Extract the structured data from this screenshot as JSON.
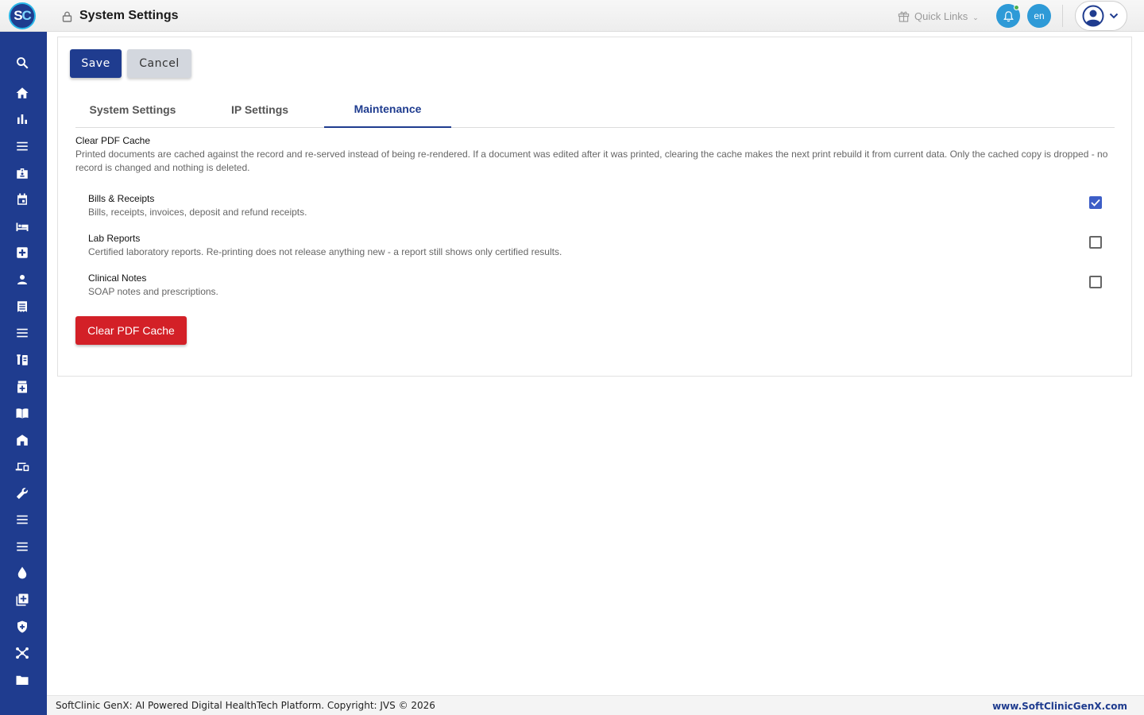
{
  "app": {
    "logo_text": "SC",
    "page_title": "System Settings",
    "quick_links_label": "Quick Links",
    "language": "en",
    "accent_color": "#1f3c8f",
    "danger_color": "#d32027"
  },
  "sidebar": {
    "items": [
      {
        "icon": "search-icon"
      },
      {
        "icon": "home-icon"
      },
      {
        "icon": "bar-chart-icon"
      },
      {
        "icon": "menu-icon"
      },
      {
        "icon": "badge-icon"
      },
      {
        "icon": "calendar-icon"
      },
      {
        "icon": "bed-icon"
      },
      {
        "icon": "medical-plus-icon"
      },
      {
        "icon": "person-icon"
      },
      {
        "icon": "receipt-icon"
      },
      {
        "icon": "menu-icon"
      },
      {
        "icon": "lab-icon"
      },
      {
        "icon": "medicine-icon"
      },
      {
        "icon": "book-icon"
      },
      {
        "icon": "building-icon"
      },
      {
        "icon": "devices-icon"
      },
      {
        "icon": "wrench-icon"
      },
      {
        "icon": "menu-icon"
      },
      {
        "icon": "menu-icon"
      },
      {
        "icon": "drop-icon"
      },
      {
        "icon": "add-box-icon"
      },
      {
        "icon": "shield-icon"
      },
      {
        "icon": "network-icon"
      },
      {
        "icon": "folder-icon"
      }
    ]
  },
  "toolbar": {
    "save_label": "Save",
    "cancel_label": "Cancel"
  },
  "tabs": [
    {
      "label": "System Settings",
      "active": false
    },
    {
      "label": "IP Settings",
      "active": false
    },
    {
      "label": "Maintenance",
      "active": true
    }
  ],
  "maintenance": {
    "title": "Clear PDF Cache",
    "description": "Printed documents are cached against the record and re-served instead of being re-rendered. If a document was edited after it was printed, clearing the cache makes the next print rebuild it from current data. Only the cached copy is dropped - no record is changed and nothing is deleted.",
    "options": [
      {
        "label": "Bills & Receipts",
        "description": "Bills, receipts, invoices, deposit and refund receipts.",
        "checked": true
      },
      {
        "label": "Lab Reports",
        "description": "Certified laboratory reports. Re-printing does not release anything new - a report still shows only certified results.",
        "checked": false
      },
      {
        "label": "Clinical Notes",
        "description": "SOAP notes and prescriptions.",
        "checked": false
      }
    ],
    "clear_button_label": "Clear PDF Cache"
  },
  "footer": {
    "copyright": "SoftClinic GenX: AI Powered Digital HealthTech Platform. Copyright: JVS © 2026",
    "website": "www.SoftClinicGenX.com"
  }
}
